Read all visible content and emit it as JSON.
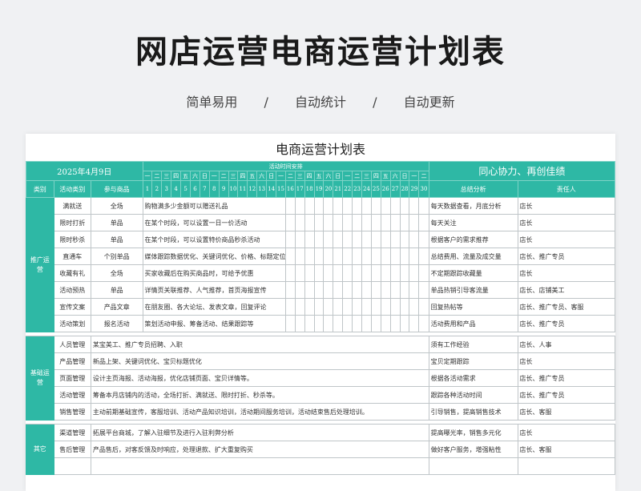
{
  "hero": {
    "title": "网店运营电商运营计划表",
    "tags": [
      "简单易用",
      "/",
      "自动统计",
      "/",
      "自动更新"
    ]
  },
  "sheet": {
    "title": "电商运营计划表",
    "date": "2025年4月9日",
    "schedule_label": "活动时间安排",
    "motto": "同心协力、再创佳绩",
    "weekdays": [
      "一",
      "二",
      "三",
      "四",
      "五",
      "六",
      "日",
      "一",
      "二",
      "三",
      "四",
      "五",
      "六",
      "日",
      "一",
      "二",
      "三",
      "四",
      "五",
      "六",
      "日",
      "一",
      "二",
      "三",
      "四",
      "五",
      "六",
      "日",
      "一",
      "二"
    ],
    "headers": {
      "category": "类别",
      "type": "活动类别",
      "item": "参与商品",
      "summary": "总结分析",
      "owner": "责任人"
    },
    "sections": [
      {
        "category": "推广运营",
        "rows": [
          {
            "type": "满就送",
            "item": "全场",
            "detail": "购物满多少金额可以赠送礼品",
            "summary": "每天数据查看，月底分析",
            "owner": "店长"
          },
          {
            "type": "限时打折",
            "item": "单品",
            "detail": "在某个时段，可以设置一日一价活动",
            "summary": "每天关注",
            "owner": "店长"
          },
          {
            "type": "限时秒杀",
            "item": "单品",
            "detail": "在某个时段，可以设置特价商品秒杀活动",
            "summary": "根据客户的需求推荐",
            "owner": "店长"
          },
          {
            "type": "直通车",
            "item": "个别单品",
            "detail": "媒体跟踪数据优化、关键词优化、价格、标题定位等一系列的报表",
            "summary": "总结费用、流量及成交量",
            "owner": "店长、推广专员"
          },
          {
            "type": "收藏有礼",
            "item": "全场",
            "detail": "买家收藏后在购买商品时，可给予优惠",
            "summary": "不定期跟踪收藏量",
            "owner": "店长"
          },
          {
            "type": "活动预热",
            "item": "单品",
            "detail": "详情页关联推荐、人气推荐，首页海报宣传",
            "summary": "单品热销引导客流量",
            "owner": "店长、店铺美工"
          },
          {
            "type": "宣传文案",
            "item": "产品文章",
            "detail": "在朋友圈、各大论坛、发表文章，回复评论",
            "summary": "回复热帖等",
            "owner": "店长、推广专员、客服"
          },
          {
            "type": "活动策划",
            "item": "报名活动",
            "detail": "策划活动申报、筹备活动、结果跟踪等",
            "summary": "活动费用和产品",
            "owner": "店长、推广专员"
          }
        ]
      },
      {
        "category": "基础运营",
        "rows": [
          {
            "type": "人员管理",
            "detail": "某宝美工、推广专员招聘、入职",
            "summary": "须有工作经验",
            "owner": "店长、人事"
          },
          {
            "type": "产品管理",
            "detail": "新品上架、关键词优化、宝贝标题优化",
            "summary": "宝贝定期跟踪",
            "owner": "店长"
          },
          {
            "type": "页面管理",
            "detail": "设计主页海报、活动海报，优化店铺页面、宝贝详情等。",
            "summary": "根据各活动需求",
            "owner": "店长、推广专员"
          },
          {
            "type": "活动管理",
            "detail": "筹备本月店铺内的活动，全场打折、满就送、限时打折、秒杀等。",
            "summary": "跟踪各种活动时间",
            "owner": "店长、推广专员"
          },
          {
            "type": "销售管理",
            "detail": "主动前期基础宣传，客服培训、活动产品知识培训，活动期间服务培训，活动结束售后处理培训。",
            "summary": "引导销售，提高销售技术",
            "owner": "店长、客服"
          }
        ]
      },
      {
        "category": "其它",
        "rows": [
          {
            "type": "渠道管理",
            "detail": "拓展平台商城，了解入驻细节及进行入驻利弊分析",
            "summary": "提高曝光率，销售多元化",
            "owner": "店长"
          },
          {
            "type": "售后管理",
            "detail": "产品售后，对客反馈及时响应，处理退款、扩大重复购买",
            "summary": "做好客户服务，增强粘性",
            "owner": "店长、客服"
          },
          {
            "type": "",
            "detail": "",
            "summary": "",
            "owner": ""
          }
        ]
      }
    ]
  }
}
